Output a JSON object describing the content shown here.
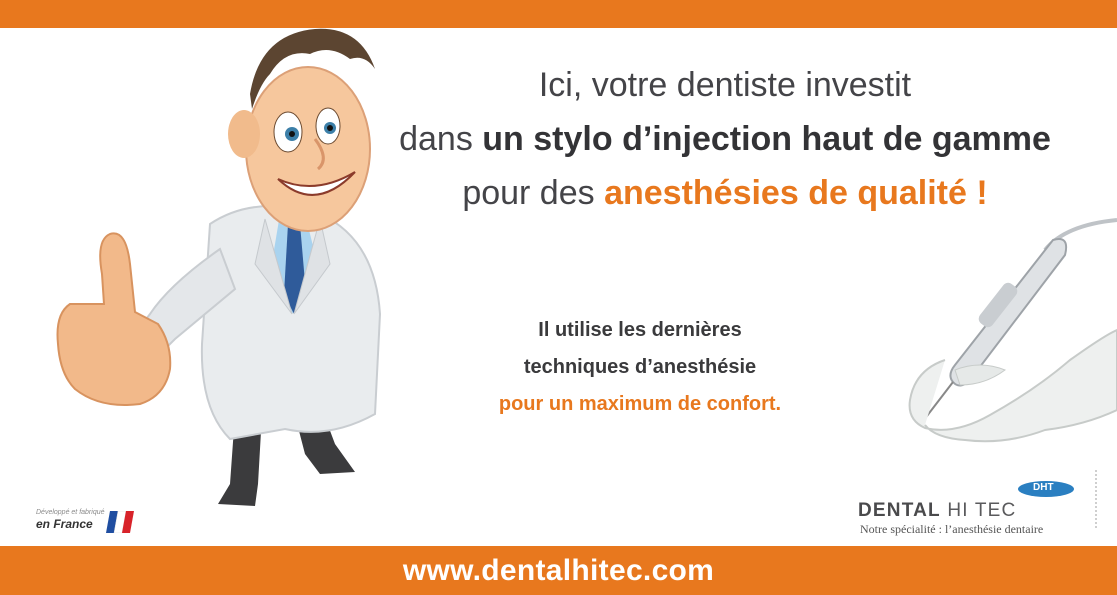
{
  "colors": {
    "accent": "#e8781e",
    "text_dark": "#444448"
  },
  "headline": {
    "line1": "Ici, votre dentiste investit",
    "line2_pre": "dans ",
    "line2_bold": "un stylo d’injection haut de gamme",
    "line3_pre": "pour des ",
    "line3_bold": "anesthésies de qualité !"
  },
  "subtext": {
    "line1": "Il utilise les dernières",
    "line2": "techniques d’anesthésie",
    "line3": "pour un maximum de confort."
  },
  "made_in_france": {
    "small": "Développé et fabriqué",
    "big": "en France"
  },
  "brand": {
    "name_bold": "DENTAL",
    "name_rest": " HI TEC",
    "badge": "DHT",
    "tagline": "Notre spécialité : l’anesthésie dentaire"
  },
  "footer": {
    "url": "www.dentalhitec.com"
  },
  "icons": [
    "doctor-illustration",
    "injection-pen-in-hand-image",
    "french-flag-icon",
    "dht-badge-logo"
  ]
}
